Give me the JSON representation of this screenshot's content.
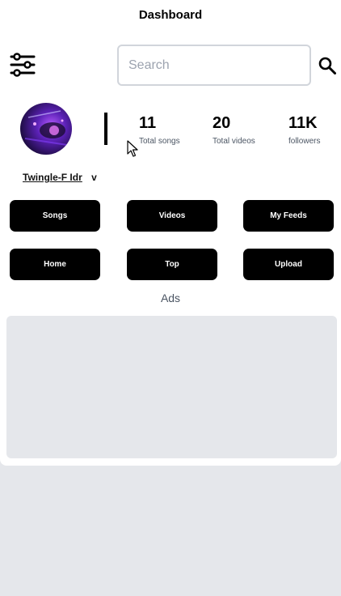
{
  "header": {
    "title": "Dashboard"
  },
  "search": {
    "placeholder": "Search",
    "value": "",
    "icon": "search-icon"
  },
  "toolbar": {
    "filter_icon": "sliders-icon"
  },
  "profile": {
    "username": "Twingle-F Idr",
    "caret": "v",
    "stats": [
      {
        "value": "11",
        "label": "Total songs"
      },
      {
        "value": "20",
        "label": "Total videos"
      },
      {
        "value": "11K",
        "label": "followers"
      }
    ]
  },
  "nav": {
    "buttons": [
      "Songs",
      "Videos",
      "My Feeds",
      "Home",
      "Top",
      "Upload"
    ]
  },
  "ads": {
    "label": "Ads"
  },
  "colors": {
    "accent": "#000000",
    "page_bg": "#e5e7eb",
    "card_bg": "#ffffff",
    "ads_bg": "#e5e7eb"
  }
}
